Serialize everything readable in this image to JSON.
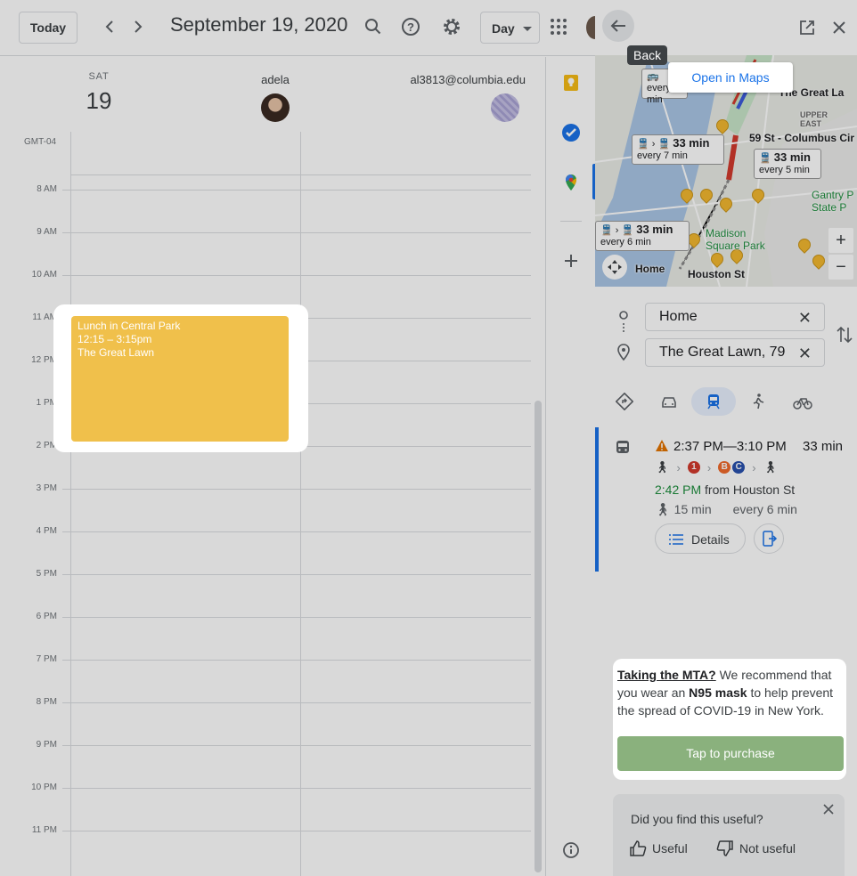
{
  "calendar": {
    "today_label": "Today",
    "date_title": "September 19, 2020",
    "view_label": "Day",
    "day_of_week": "SAT",
    "day_number": "19",
    "timezone": "GMT-04",
    "people": [
      {
        "name": "adela"
      },
      {
        "name": "al3813@columbia.edu"
      }
    ],
    "hours": [
      "8 AM",
      "9 AM",
      "10 AM",
      "11 AM",
      "12 PM",
      "1 PM",
      "2 PM",
      "3 PM",
      "4 PM",
      "5 PM",
      "6 PM",
      "7 PM",
      "8 PM",
      "9 PM",
      "10 PM",
      "11 PM"
    ],
    "event": {
      "title": "Lunch in Central Park",
      "time": "12:15 – 3:15pm",
      "location": "The Great Lawn",
      "color": "#f0c04b"
    }
  },
  "maps": {
    "back_tooltip": "Back",
    "open_in_maps": "Open in Maps",
    "map_labels": {
      "great_lawn": "The Great La",
      "columbus": "59 St - Columbus Cir",
      "madison": "Madison Square Park",
      "gantry": "Gantry P State P",
      "home": "Home",
      "houston": "Houston St",
      "upper_east": "UPPER EAST"
    },
    "transit_cards": [
      {
        "time": "",
        "freq": "every 6 min"
      },
      {
        "time": "33 min",
        "freq": "every 7 min"
      },
      {
        "time": "33 min",
        "freq": "every 5 min"
      },
      {
        "time": "33 min",
        "freq": "every 6 min"
      }
    ],
    "origin": "Home",
    "destination": "The Great Lawn, 79",
    "route": {
      "time_range": "2:37 PM—3:10 PM",
      "duration": "33 min",
      "lines": [
        "1",
        "B",
        "C"
      ],
      "depart_time": "2:42 PM",
      "depart_from": "from Houston St",
      "walk": "15 min",
      "frequency": "every 6 min",
      "details_label": "Details"
    },
    "mta": {
      "link": "Taking the MTA?",
      "text_a": " We recommend that you wear an ",
      "bold": "N95 mask",
      "text_b": " to help prevent the spread of COVID-19 in New York.",
      "button": "Tap to purchase"
    },
    "feedback": {
      "question": "Did you find this useful?",
      "useful": "Useful",
      "not_useful": "Not useful"
    },
    "colors": {
      "line_1": "#d23a2d",
      "line_b": "#f06a2c",
      "line_c": "#2850ad",
      "accent": "#1a73e8"
    }
  }
}
